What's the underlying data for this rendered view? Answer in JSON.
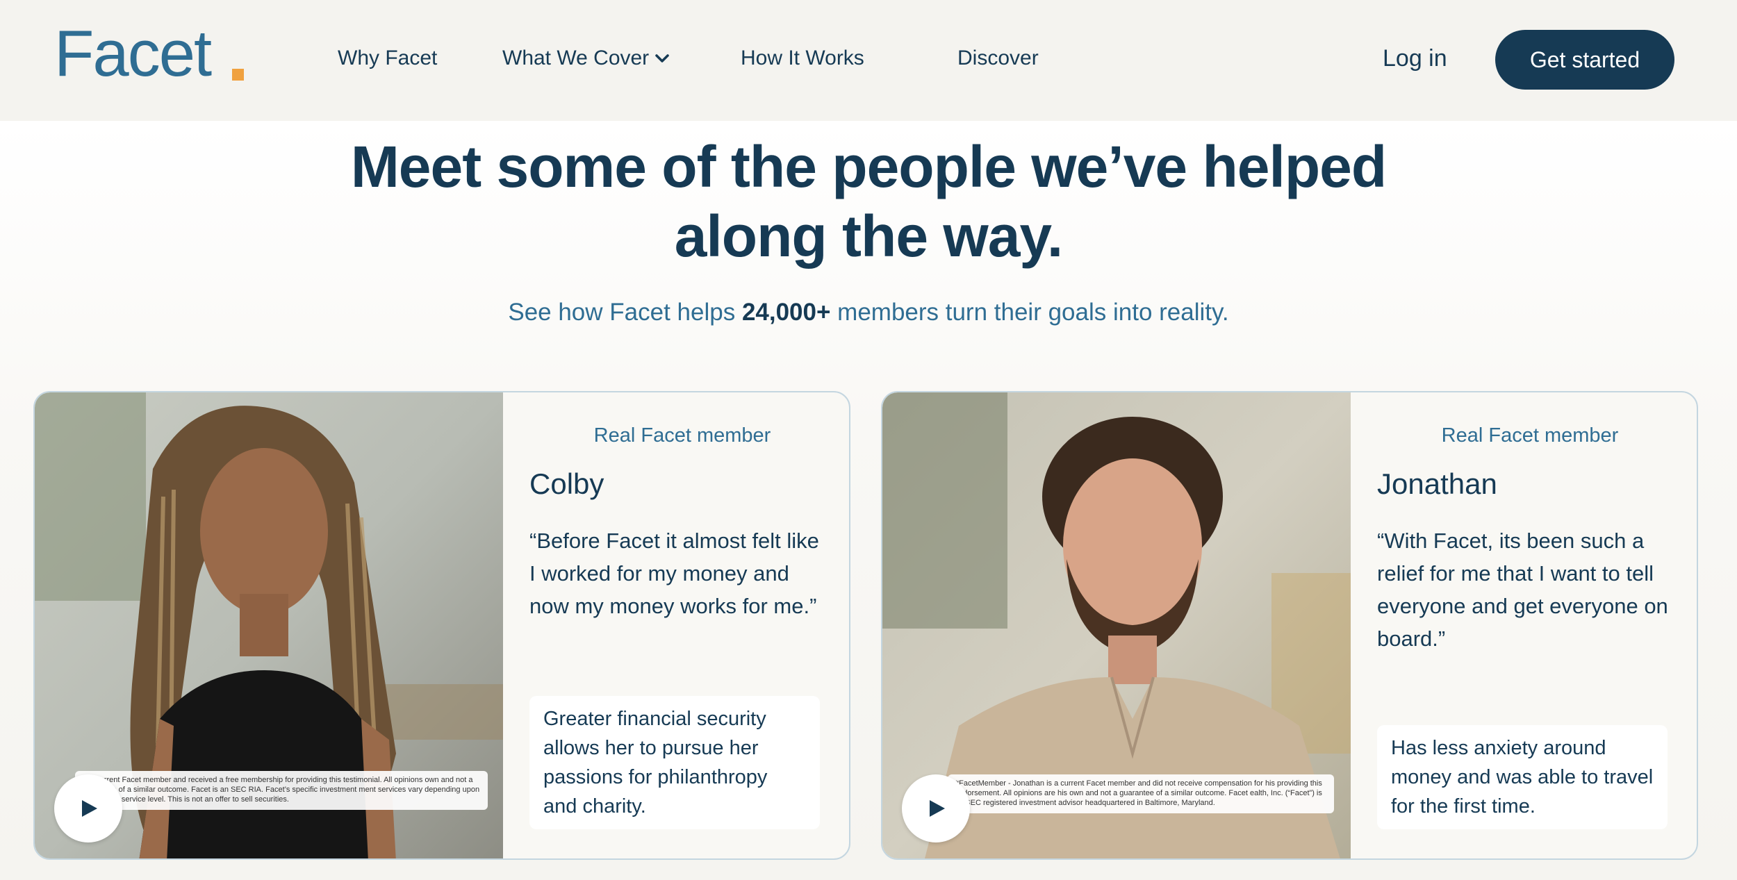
{
  "nav": {
    "logo": "Facet",
    "links": [
      "Why Facet",
      "What We Cover",
      "How It Works",
      "Discover"
    ],
    "login": "Log in",
    "cta": "Get started",
    "icons": {
      "dropdown": "chevron-down-icon"
    }
  },
  "hero": {
    "headline": "Meet some of the people we’ve helped along the way.",
    "sub_prefix": "See how Facet helps ",
    "sub_bold": "24,000+",
    "sub_suffix": " members turn their goals into reality."
  },
  "testimonials": [
    {
      "tag": "Real Facet member",
      "name": "Colby",
      "quote": "“Before Facet it almost felt like I worked for my money and now my money works for me.”",
      "outcome": "Greater financial security allows her to pursue her passions for philanthropy and charity.",
      "disclaimer": "is a current Facet member and received a free membership for providing this testimonial. All opinions own and not a guarantee of a similar outcome. Facet is an SEC RIA. Facet’s specific investment ment services vary depending upon the chosen service level. This is not an offer to sell securities."
    },
    {
      "tag": "Real Facet member",
      "name": "Jonathan",
      "quote": "“With Facet, its been such a relief for me that I want to tell everyone and get everyone on board.”",
      "outcome": "Has less anxiety around money and was able to travel for the first time.",
      "disclaimer": "#FacetMember - Jonathan is a current Facet member and did not receive compensation for his providing this endorsement. All opinions are his own and not a guarantee of a similar outcome. Facet ealth, Inc. (“Facet”) is an SEC registered investment advisor headquartered in Baltimore, Maryland."
    }
  ],
  "colors": {
    "navy": "#163a54",
    "blue": "#2f6d93",
    "accent": "#f0a13f",
    "background": "#f7f6f2"
  }
}
